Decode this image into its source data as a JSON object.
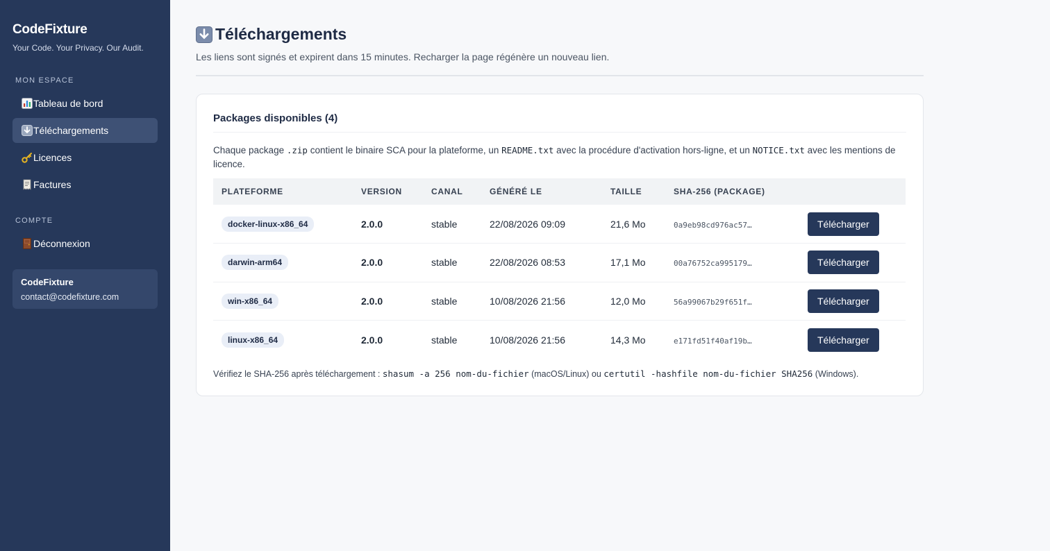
{
  "sidebar": {
    "brand": "CodeFixture",
    "tagline": "Your Code. Your Privacy. Our Audit.",
    "section_space": "MON ESPACE",
    "items": [
      {
        "icon": "bar-chart-icon",
        "label": "Tableau de bord"
      },
      {
        "icon": "download-arrow-icon",
        "label": "Téléchargements"
      },
      {
        "icon": "key-icon",
        "label": "Licences"
      },
      {
        "icon": "receipt-icon",
        "label": "Factures"
      }
    ],
    "section_account": "COMPTE",
    "account_items": [
      {
        "icon": "door-icon",
        "label": "Déconnexion"
      }
    ],
    "user": {
      "name": "CodeFixture",
      "email": "contact@codefixture.com"
    }
  },
  "header": {
    "title": "Téléchargements",
    "subtitle": "Les liens sont signés et expirent dans 15 minutes. Recharger la page régénère un nouveau lien."
  },
  "card": {
    "title": "Packages disponibles (4)",
    "desc_1": "Chaque package ",
    "desc_code_1": ".zip",
    "desc_2": " contient le binaire SCA pour la plateforme, un ",
    "desc_code_2": "README.txt",
    "desc_3": " avec la procédure d'activation hors-ligne, et un ",
    "desc_code_3": "NOTICE.txt",
    "desc_4": " avec les mentions de licence.",
    "columns": [
      "PLATEFORME",
      "VERSION",
      "CANAL",
      "GÉNÉRÉ LE",
      "TAILLE",
      "SHA-256 (PACKAGE)",
      ""
    ],
    "rows": [
      {
        "platform": "docker-linux-x86_64",
        "version": "2.0.0",
        "channel": "stable",
        "generated": "22/08/2026 09:09",
        "size": "21,6 Mo",
        "sha": "0a9eb98cd976ac57…",
        "action": "Télécharger"
      },
      {
        "platform": "darwin-arm64",
        "version": "2.0.0",
        "channel": "stable",
        "generated": "22/08/2026 08:53",
        "size": "17,1 Mo",
        "sha": "00a76752ca995179…",
        "action": "Télécharger"
      },
      {
        "platform": "win-x86_64",
        "version": "2.0.0",
        "channel": "stable",
        "generated": "10/08/2026 21:56",
        "size": "12,0 Mo",
        "sha": "56a99067b29f651f…",
        "action": "Télécharger"
      },
      {
        "platform": "linux-x86_64",
        "version": "2.0.0",
        "channel": "stable",
        "generated": "10/08/2026 21:56",
        "size": "14,3 Mo",
        "sha": "e171fd51f40af19b…",
        "action": "Télécharger"
      }
    ],
    "footer_1": "Vérifiez le SHA-256 après téléchargement : ",
    "footer_code_1": "shasum -a 256 nom-du-fichier",
    "footer_2": " (macOS/Linux) ou ",
    "footer_code_2": "certutil -hashfile nom-du-fichier SHA256",
    "footer_3": " (Windows)."
  }
}
